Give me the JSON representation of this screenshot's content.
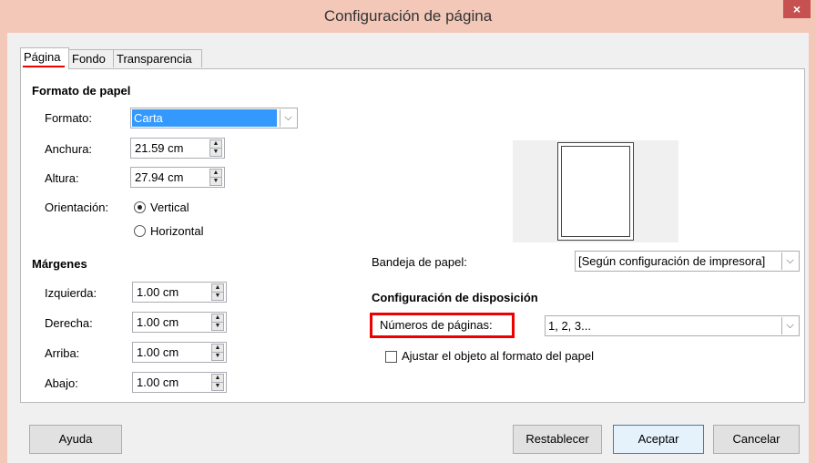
{
  "window": {
    "title": "Configuración de página",
    "close_glyph": "×"
  },
  "tabs": [
    {
      "label": "Página",
      "active": true
    },
    {
      "label": "Fondo",
      "active": false
    },
    {
      "label": "Transparencia",
      "active": false
    }
  ],
  "paper_format": {
    "section_title": "Formato de papel",
    "format_label": "Formato:",
    "format_value": "Carta",
    "width_label": "Anchura:",
    "width_value": "21.59 cm",
    "height_label": "Altura:",
    "height_value": "27.94 cm",
    "orientation_label": "Orientación:",
    "orientation_vertical": "Vertical",
    "orientation_horizontal": "Horizontal",
    "orientation_selected": "Vertical"
  },
  "margins": {
    "section_title": "Márgenes",
    "left_label": "Izquierda:",
    "left_value": "1.00 cm",
    "right_label": "Derecha:",
    "right_value": "1.00 cm",
    "top_label": "Arriba:",
    "top_value": "1.00 cm",
    "bottom_label": "Abajo:",
    "bottom_value": "1.00 cm"
  },
  "paper_tray": {
    "label": "Bandeja de papel:",
    "value": "[Según configuración de impresora]"
  },
  "layout": {
    "section_title": "Configuración de disposición",
    "page_numbers_label": "Números de páginas:",
    "page_numbers_value": "1, 2, 3...",
    "fit_object_label": "Ajustar el objeto al formato del papel",
    "fit_object_checked": false
  },
  "buttons": {
    "help": "Ayuda",
    "reset": "Restablecer",
    "ok": "Aceptar",
    "cancel": "Cancelar"
  },
  "colors": {
    "titlebar": "#f3c8b8",
    "highlight_box": "#e00000",
    "selection": "#3399ff"
  }
}
